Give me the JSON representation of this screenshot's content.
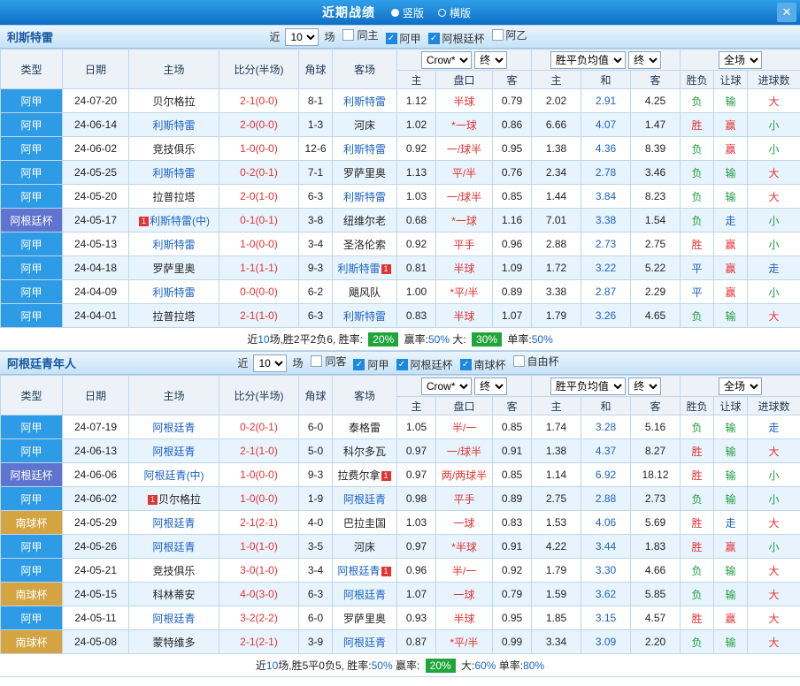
{
  "colors": {
    "topbar_from": "#2f9fe9",
    "topbar_to": "#0e6fc5",
    "section_from": "#eaf5fe",
    "section_to": "#c6e2f7",
    "header_bg": "#edf2f8",
    "row_alt": "#e8f4fd",
    "grid": "#bfd6e9",
    "type_league": "#2d9be5",
    "type_cup": "#5f74ce",
    "type_south": "#d4a443",
    "red": "#e23434",
    "green": "#1e9e3e",
    "blue": "#1a62c6",
    "team_blue": "#1a62c6",
    "badge_green": "#1fa539"
  },
  "topbar": {
    "title": "近期战绩",
    "orientations": [
      {
        "label": "竖版",
        "selected": true
      },
      {
        "label": "横版",
        "selected": false
      }
    ],
    "close_label": "✕"
  },
  "controls_common": {
    "recent_prefix": "近",
    "recent_value": "10",
    "recent_suffix": "场"
  },
  "table_header": {
    "col_type": "类型",
    "col_date": "日期",
    "col_home": "主场",
    "col_score": "比分(半场)",
    "col_corner": "角球",
    "col_away": "客场",
    "odds_company": "Crow*",
    "odds_period": "终",
    "avg_label": "胜平负均值",
    "avg_period": "终",
    "scope_label": "全场",
    "sub_home": "主",
    "sub_handicap": "盘口",
    "sub_away": "客",
    "sub_avg_home": "主",
    "sub_avg_draw": "和",
    "sub_avg_away": "客",
    "sub_result": "胜负",
    "sub_let": "让球",
    "sub_goals": "进球数"
  },
  "sections": [
    {
      "team": "利斯特雷",
      "checkboxes": [
        {
          "label": "同主",
          "checked": false
        },
        {
          "label": "阿甲",
          "checked": true
        },
        {
          "label": "阿根廷杯",
          "checked": true
        },
        {
          "label": "阿乙",
          "checked": false
        }
      ],
      "rows": [
        {
          "type": "阿甲",
          "date": "24-07-20",
          "home": {
            "name": "贝尔格拉"
          },
          "score": "2-1(0-0)",
          "corner": "8-1",
          "away": {
            "name": "利斯特雷",
            "hl": true
          },
          "odds": [
            "1.12",
            "半球",
            "0.79"
          ],
          "avg": [
            "2.02",
            "2.91",
            "4.25"
          ],
          "results": [
            "负",
            "输",
            "大"
          ]
        },
        {
          "type": "阿甲",
          "date": "24-06-14",
          "home": {
            "name": "利斯特雷",
            "hl": true
          },
          "score": "2-0(0-0)",
          "corner": "1-3",
          "away": {
            "name": "河床"
          },
          "odds": [
            "1.02",
            "*一球",
            "0.86"
          ],
          "avg": [
            "6.66",
            "4.07",
            "1.47"
          ],
          "results": [
            "胜",
            "赢",
            "小"
          ]
        },
        {
          "type": "阿甲",
          "date": "24-06-02",
          "home": {
            "name": "竞技俱乐"
          },
          "score": "1-0(0-0)",
          "corner": "12-6",
          "away": {
            "name": "利斯特雷",
            "hl": true
          },
          "odds": [
            "0.92",
            "一/球半",
            "0.95"
          ],
          "avg": [
            "1.38",
            "4.36",
            "8.39"
          ],
          "results": [
            "负",
            "赢",
            "小"
          ]
        },
        {
          "type": "阿甲",
          "date": "24-05-25",
          "home": {
            "name": "利斯特雷",
            "hl": true
          },
          "score": "0-2(0-1)",
          "corner": "7-1",
          "away": {
            "name": "罗萨里奥"
          },
          "odds": [
            "1.13",
            "平/半",
            "0.76"
          ],
          "avg": [
            "2.34",
            "2.78",
            "3.46"
          ],
          "results": [
            "负",
            "输",
            "大"
          ]
        },
        {
          "type": "阿甲",
          "date": "24-05-20",
          "home": {
            "name": "拉普拉塔"
          },
          "score": "2-0(1-0)",
          "corner": "6-3",
          "away": {
            "name": "利斯特雷",
            "hl": true
          },
          "odds": [
            "1.03",
            "一/球半",
            "0.85"
          ],
          "avg": [
            "1.44",
            "3.84",
            "8.23"
          ],
          "results": [
            "负",
            "输",
            "大"
          ]
        },
        {
          "type": "阿根廷杯",
          "date": "24-05-17",
          "home": {
            "name": "利斯特雷(中)",
            "hl": true,
            "badge": "1",
            "badge_pos": "before"
          },
          "score": "0-1(0-1)",
          "corner": "3-8",
          "away": {
            "name": "纽维尔老"
          },
          "odds": [
            "0.68",
            "*一球",
            "1.16"
          ],
          "avg": [
            "7.01",
            "3.38",
            "1.54"
          ],
          "results": [
            "负",
            "走",
            "小"
          ]
        },
        {
          "type": "阿甲",
          "date": "24-05-13",
          "home": {
            "name": "利斯特雷",
            "hl": true
          },
          "score": "1-0(0-0)",
          "corner": "3-4",
          "away": {
            "name": "圣洛伦索"
          },
          "odds": [
            "0.92",
            "平手",
            "0.96"
          ],
          "avg": [
            "2.88",
            "2.73",
            "2.75"
          ],
          "results": [
            "胜",
            "赢",
            "小"
          ]
        },
        {
          "type": "阿甲",
          "date": "24-04-18",
          "home": {
            "name": "罗萨里奥"
          },
          "score": "1-1(1-1)",
          "corner": "9-3",
          "away": {
            "name": "利斯特雷",
            "hl": true,
            "badge": "1",
            "badge_pos": "after"
          },
          "odds": [
            "0.81",
            "半球",
            "1.09"
          ],
          "avg": [
            "1.72",
            "3.22",
            "5.22"
          ],
          "results": [
            "平",
            "赢",
            "走"
          ]
        },
        {
          "type": "阿甲",
          "date": "24-04-09",
          "home": {
            "name": "利斯特雷",
            "hl": true
          },
          "score": "0-0(0-0)",
          "corner": "6-2",
          "away": {
            "name": "飓风队"
          },
          "odds": [
            "1.00",
            "*平/半",
            "0.89"
          ],
          "avg": [
            "3.38",
            "2.87",
            "2.29"
          ],
          "results": [
            "平",
            "赢",
            "小"
          ]
        },
        {
          "type": "阿甲",
          "date": "24-04-01",
          "home": {
            "name": "拉普拉塔"
          },
          "score": "2-1(1-0)",
          "corner": "6-3",
          "away": {
            "name": "利斯特雷",
            "hl": true
          },
          "odds": [
            "0.83",
            "半球",
            "1.07"
          ],
          "avg": [
            "1.79",
            "3.26",
            "4.65"
          ],
          "results": [
            "负",
            "输",
            "大"
          ]
        }
      ],
      "footer": [
        {
          "t": "text",
          "v": "近"
        },
        {
          "t": "num",
          "v": "10"
        },
        {
          "t": "text",
          "v": "场,胜2平2负6, 胜率: "
        },
        {
          "t": "badge",
          "v": "20%"
        },
        {
          "t": "text",
          "v": " 赢率:"
        },
        {
          "t": "num",
          "v": "50%"
        },
        {
          "t": "text",
          "v": " 大: "
        },
        {
          "t": "badge",
          "v": "30%"
        },
        {
          "t": "text",
          "v": " 单率:"
        },
        {
          "t": "num",
          "v": "50%"
        }
      ]
    },
    {
      "team": "阿根廷青年人",
      "checkboxes": [
        {
          "label": "同客",
          "checked": false
        },
        {
          "label": "阿甲",
          "checked": true
        },
        {
          "label": "阿根廷杯",
          "checked": true
        },
        {
          "label": "南球杯",
          "checked": true
        },
        {
          "label": "自由杯",
          "checked": false
        }
      ],
      "rows": [
        {
          "type": "阿甲",
          "date": "24-07-19",
          "home": {
            "name": "阿根廷青",
            "hl": true
          },
          "score": "0-2(0-1)",
          "corner": "6-0",
          "away": {
            "name": "泰格雷"
          },
          "odds": [
            "1.05",
            "半/一",
            "0.85"
          ],
          "avg": [
            "1.74",
            "3.28",
            "5.16"
          ],
          "results": [
            "负",
            "输",
            "走"
          ]
        },
        {
          "type": "阿甲",
          "date": "24-06-13",
          "home": {
            "name": "阿根廷青",
            "hl": true
          },
          "score": "2-1(1-0)",
          "corner": "5-0",
          "away": {
            "name": "科尔多瓦"
          },
          "odds": [
            "0.97",
            "一/球半",
            "0.91"
          ],
          "avg": [
            "1.38",
            "4.37",
            "8.27"
          ],
          "results": [
            "胜",
            "输",
            "大"
          ]
        },
        {
          "type": "阿根廷杯",
          "date": "24-06-06",
          "home": {
            "name": "阿根廷青(中)",
            "hl": true
          },
          "score": "1-0(0-0)",
          "corner": "9-3",
          "away": {
            "name": "拉费尔拿",
            "badge": "1",
            "badge_pos": "after"
          },
          "odds": [
            "0.97",
            "两/两球半",
            "0.85"
          ],
          "avg": [
            "1.14",
            "6.92",
            "18.12"
          ],
          "results": [
            "胜",
            "输",
            "小"
          ]
        },
        {
          "type": "阿甲",
          "date": "24-06-02",
          "home": {
            "name": "贝尔格拉",
            "badge": "1",
            "badge_pos": "before"
          },
          "score": "1-0(0-0)",
          "corner": "1-9",
          "away": {
            "name": "阿根廷青",
            "hl": true
          },
          "odds": [
            "0.98",
            "平手",
            "0.89"
          ],
          "avg": [
            "2.75",
            "2.88",
            "2.73"
          ],
          "results": [
            "负",
            "输",
            "小"
          ]
        },
        {
          "type": "南球杯",
          "date": "24-05-29",
          "home": {
            "name": "阿根廷青",
            "hl": true
          },
          "score": "2-1(2-1)",
          "corner": "4-0",
          "away": {
            "name": "巴拉圭国"
          },
          "odds": [
            "1.03",
            "一球",
            "0.83"
          ],
          "avg": [
            "1.53",
            "4.06",
            "5.69"
          ],
          "results": [
            "胜",
            "走",
            "大"
          ]
        },
        {
          "type": "阿甲",
          "date": "24-05-26",
          "home": {
            "name": "阿根廷青",
            "hl": true
          },
          "score": "1-0(1-0)",
          "corner": "3-5",
          "away": {
            "name": "河床"
          },
          "odds": [
            "0.97",
            "*半球",
            "0.91"
          ],
          "avg": [
            "4.22",
            "3.44",
            "1.83"
          ],
          "results": [
            "胜",
            "赢",
            "小"
          ]
        },
        {
          "type": "阿甲",
          "date": "24-05-21",
          "home": {
            "name": "竞技俱乐"
          },
          "score": "3-0(1-0)",
          "corner": "3-4",
          "away": {
            "name": "阿根廷青",
            "hl": true,
            "badge": "1",
            "badge_pos": "after"
          },
          "odds": [
            "0.96",
            "半/一",
            "0.92"
          ],
          "avg": [
            "1.79",
            "3.30",
            "4.66"
          ],
          "results": [
            "负",
            "输",
            "大"
          ]
        },
        {
          "type": "南球杯",
          "date": "24-05-15",
          "home": {
            "name": "科林蒂安"
          },
          "score": "4-0(3-0)",
          "corner": "6-3",
          "away": {
            "name": "阿根廷青",
            "hl": true
          },
          "odds": [
            "1.07",
            "一球",
            "0.79"
          ],
          "avg": [
            "1.59",
            "3.62",
            "5.85"
          ],
          "results": [
            "负",
            "输",
            "大"
          ]
        },
        {
          "type": "阿甲",
          "date": "24-05-11",
          "home": {
            "name": "阿根廷青",
            "hl": true
          },
          "score": "3-2(2-2)",
          "corner": "6-0",
          "away": {
            "name": "罗萨里奥"
          },
          "odds": [
            "0.93",
            "半球",
            "0.95"
          ],
          "avg": [
            "1.85",
            "3.15",
            "4.57"
          ],
          "results": [
            "胜",
            "赢",
            "大"
          ]
        },
        {
          "type": "南球杯",
          "date": "24-05-08",
          "home": {
            "name": "蒙特维多"
          },
          "score": "2-1(2-1)",
          "corner": "3-9",
          "away": {
            "name": "阿根廷青",
            "hl": true
          },
          "odds": [
            "0.87",
            "*平/半",
            "0.99"
          ],
          "avg": [
            "3.34",
            "3.09",
            "2.20"
          ],
          "results": [
            "负",
            "输",
            "大"
          ]
        }
      ],
      "footer": [
        {
          "t": "text",
          "v": "近"
        },
        {
          "t": "num",
          "v": "10"
        },
        {
          "t": "text",
          "v": "场,胜5平0负5, 胜率:"
        },
        {
          "t": "num",
          "v": "50%"
        },
        {
          "t": "text",
          "v": " 赢率: "
        },
        {
          "t": "badge",
          "v": "20%"
        },
        {
          "t": "text",
          "v": " 大:"
        },
        {
          "t": "num",
          "v": "60%"
        },
        {
          "t": "text",
          "v": " 单率:"
        },
        {
          "t": "num",
          "v": "80%"
        }
      ]
    }
  ]
}
